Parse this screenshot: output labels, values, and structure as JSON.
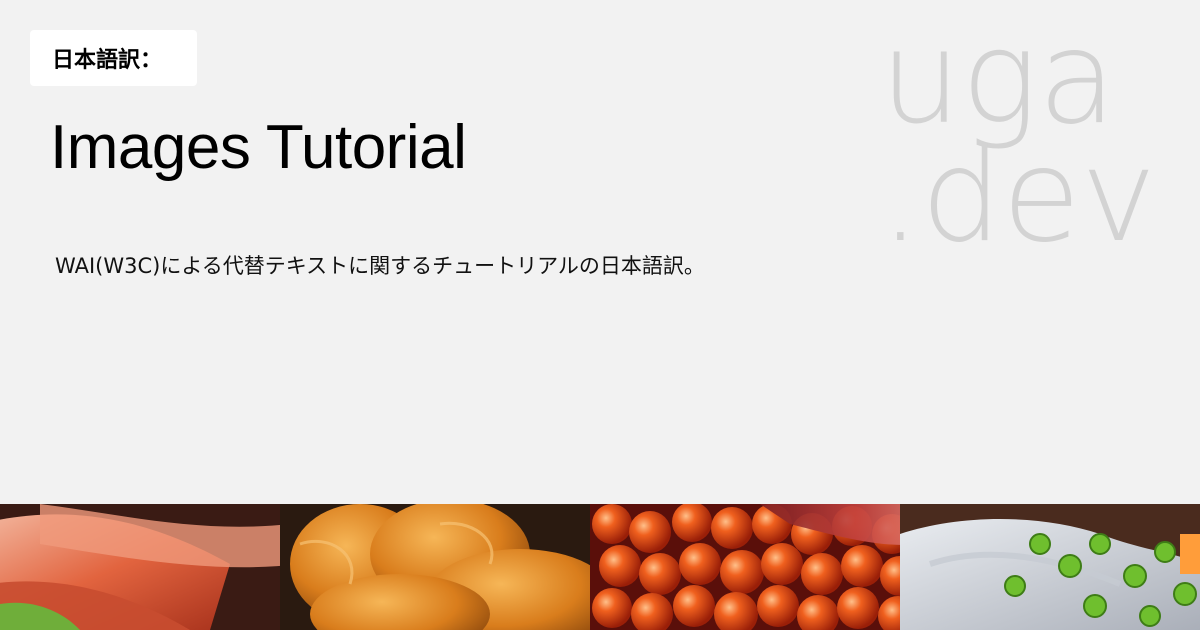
{
  "badge": {
    "label": "日本語訳："
  },
  "page": {
    "title": "Images Tutorial",
    "description": "WAI(W3C)による代替テキストに関するチュートリアルの日本語訳。"
  },
  "brand": {
    "line1": "uga",
    "line2": ".dev"
  },
  "colors": {
    "background": "#f2f2f2",
    "badge_bg": "#ffffff",
    "brand_text": "#d3d3d3",
    "uni": "#e8902a",
    "ikura": "#e2451a",
    "tuna": "#c8433f",
    "scallion": "#6fbf2e"
  }
}
